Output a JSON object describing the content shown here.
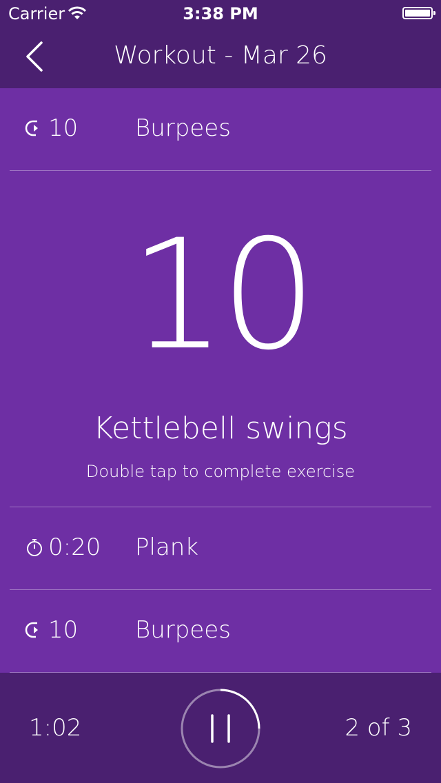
{
  "status_bar": {
    "carrier": "Carrier",
    "time": "3:38 PM",
    "wifi_icon": "wifi-icon",
    "battery_icon": "battery-icon"
  },
  "nav": {
    "title": "Workout - Mar 26",
    "back_icon": "chevron-left-icon"
  },
  "colors": {
    "header_bg": "#4a2070",
    "content_bg": "#6e2fa4",
    "text": "#ffffff"
  },
  "exercises": {
    "previous": {
      "icon": "reps-icon",
      "value": "10",
      "name": "Burpees"
    },
    "current": {
      "count": "10",
      "name": "Kettlebell swings",
      "hint": "Double tap to complete exercise"
    },
    "next": [
      {
        "icon": "stopwatch-icon",
        "value": "0:20",
        "name": "Plank"
      },
      {
        "icon": "reps-icon",
        "value": "10",
        "name": "Burpees"
      }
    ]
  },
  "footer": {
    "elapsed": "1:02",
    "progress": "2 of 3",
    "pause_icon": "pause-icon"
  }
}
